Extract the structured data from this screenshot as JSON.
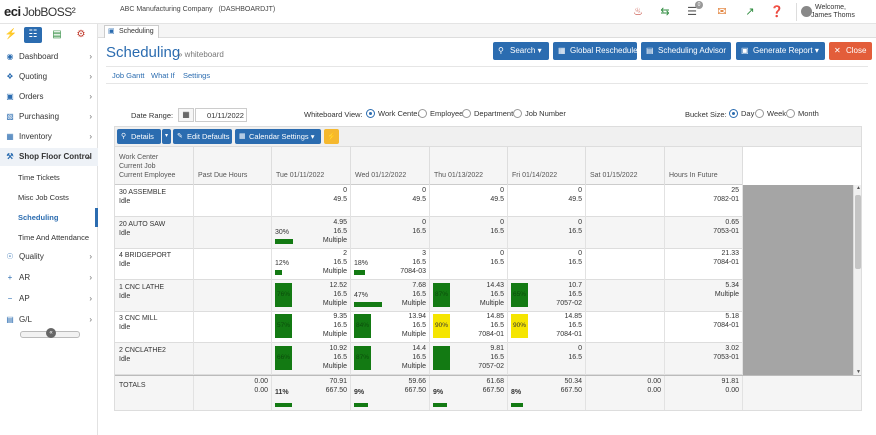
{
  "app": {
    "brand": "eci",
    "product": "JobBOSS²",
    "company": "ABC Manufacturing Company",
    "session": "(DASHBOARDJT)",
    "welcome": "Welcome,",
    "user": "James Thoms",
    "alert_count": "0"
  },
  "sidebar": {
    "items": [
      {
        "label": "Dashboard",
        "icon": "gauge-icon"
      },
      {
        "label": "Quoting",
        "icon": "quote-icon"
      },
      {
        "label": "Orders",
        "icon": "truck-icon"
      },
      {
        "label": "Purchasing",
        "icon": "cart-icon"
      },
      {
        "label": "Inventory",
        "icon": "inventory-icon"
      },
      {
        "label": "Shop Floor Control",
        "icon": "wrench-icon"
      },
      {
        "label": "Quality",
        "icon": "globe-icon"
      },
      {
        "label": "AR",
        "icon": "plus-icon"
      },
      {
        "label": "AP",
        "icon": "minus-icon"
      },
      {
        "label": "G/L",
        "icon": "ledger-icon"
      }
    ],
    "sub_items": [
      "Time Tickets",
      "Misc Job Costs",
      "Scheduling",
      "Time And Attendance"
    ],
    "active_sub": "Scheduling"
  },
  "tab": {
    "label": "Scheduling"
  },
  "header": {
    "title": "Scheduling",
    "subtitle": "» whiteboard",
    "buttons": {
      "search": "Search",
      "reschedule": "Global Reschedule",
      "advisor": "Scheduling Advisor",
      "report": "Generate Report",
      "close": "Close"
    }
  },
  "subnav": {
    "links": [
      "Job Gantt",
      "What If",
      "Settings"
    ]
  },
  "filters": {
    "date_label": "Date Range:",
    "date_value": "01/11/2022",
    "view_label": "Whiteboard View:",
    "view_options": [
      "Work Center",
      "Employee",
      "Department",
      "Job Number"
    ],
    "view_selected": "Work Center",
    "bucket_label": "Bucket Size:",
    "bucket_options": [
      "Day",
      "Week",
      "Month"
    ],
    "bucket_selected": "Day"
  },
  "toolbar": {
    "details": "Details",
    "edit_defaults": "Edit Defaults",
    "calendar_settings": "Calendar Settings"
  },
  "grid": {
    "header_lines": [
      "Work Center",
      "Current Job",
      "Current Employee"
    ],
    "columns": [
      "Past Due Hours",
      "Tue 01/11/2022",
      "Wed 01/12/2022",
      "Thu 01/13/2022",
      "Fri 01/14/2022",
      "Sat 01/15/2022",
      "Hours In Future"
    ],
    "rows": [
      {
        "name": "30 ASSEMBLE",
        "status": "Idle",
        "days": [
          {
            "v1": "0",
            "v2": "49.5",
            "v3": "",
            "pct": "",
            "fill": 0,
            "style": "none"
          },
          {
            "v1": "0",
            "v2": "49.5",
            "v3": "",
            "pct": "",
            "fill": 0,
            "style": "none"
          },
          {
            "v1": "0",
            "v2": "49.5",
            "v3": "",
            "pct": "",
            "fill": 0,
            "style": "none"
          },
          {
            "v1": "0",
            "v2": "49.5",
            "v3": "",
            "pct": "",
            "fill": 0,
            "style": "none"
          }
        ],
        "future": {
          "v1": "25",
          "v2": "7082-01"
        }
      },
      {
        "name": "20 AUTO SAW",
        "status": "Idle",
        "days": [
          {
            "v1": "4.95",
            "v2": "16.5",
            "v3": "Multiple",
            "pct": "30%",
            "fill": 0.3,
            "style": "bar"
          },
          {
            "v1": "0",
            "v2": "16.5",
            "v3": "",
            "pct": "",
            "fill": 0,
            "style": "none"
          },
          {
            "v1": "0",
            "v2": "16.5",
            "v3": "",
            "pct": "",
            "fill": 0,
            "style": "none"
          },
          {
            "v1": "0",
            "v2": "16.5",
            "v3": "",
            "pct": "",
            "fill": 0,
            "style": "none"
          }
        ],
        "future": {
          "v1": "0.65",
          "v2": "7053-01"
        }
      },
      {
        "name": "4 BRIDGEPORT",
        "status": "Idle",
        "days": [
          {
            "v1": "2",
            "v2": "16.5",
            "v3": "Multiple",
            "pct": "12%",
            "fill": 0.12,
            "style": "bar"
          },
          {
            "v1": "3",
            "v2": "16.5",
            "v3": "7084-03",
            "pct": "18%",
            "fill": 0.18,
            "style": "bar"
          },
          {
            "v1": "0",
            "v2": "16.5",
            "v3": "",
            "pct": "",
            "fill": 0,
            "style": "none"
          },
          {
            "v1": "0",
            "v2": "16.5",
            "v3": "",
            "pct": "",
            "fill": 0,
            "style": "none"
          }
        ],
        "future": {
          "v1": "21.33",
          "v2": "7084-01"
        }
      },
      {
        "name": "1 CNC LATHE",
        "status": "Idle",
        "days": [
          {
            "v1": "12.52",
            "v2": "16.5",
            "v3": "Multiple",
            "pct": "76%",
            "fill": 0.76,
            "style": "box"
          },
          {
            "v1": "7.68",
            "v2": "16.5",
            "v3": "Multiple",
            "pct": "47%",
            "fill": 0.47,
            "style": "bar"
          },
          {
            "v1": "14.43",
            "v2": "16.5",
            "v3": "Multiple",
            "pct": "87%",
            "fill": 0.87,
            "style": "box"
          },
          {
            "v1": "10.7",
            "v2": "16.5",
            "v3": "7057-02",
            "pct": "65%",
            "fill": 0.65,
            "style": "box"
          }
        ],
        "future": {
          "v1": "5.34",
          "v2": "Multiple"
        }
      },
      {
        "name": "3 CNC MILL",
        "status": "Idle",
        "days": [
          {
            "v1": "9.35",
            "v2": "16.5",
            "v3": "Multiple",
            "pct": "57%",
            "fill": 0.57,
            "style": "box"
          },
          {
            "v1": "13.94",
            "v2": "16.5",
            "v3": "Multiple",
            "pct": "84%",
            "fill": 0.84,
            "style": "box"
          },
          {
            "v1": "14.85",
            "v2": "16.5",
            "v3": "7084-01",
            "pct": "90%",
            "fill": 0.9,
            "style": "yellow"
          },
          {
            "v1": "14.85",
            "v2": "16.5",
            "v3": "7084-01",
            "pct": "90%",
            "fill": 0.9,
            "style": "yellow"
          }
        ],
        "future": {
          "v1": "5.18",
          "v2": "7084-01"
        }
      },
      {
        "name": "2 CNCLATHE2",
        "status": "Idle",
        "days": [
          {
            "v1": "10.92",
            "v2": "16.5",
            "v3": "Multiple",
            "pct": "66%",
            "fill": 0.66,
            "style": "box"
          },
          {
            "v1": "14.4",
            "v2": "16.5",
            "v3": "Multiple",
            "pct": "87%",
            "fill": 0.87,
            "style": "box"
          },
          {
            "v1": "9.81",
            "v2": "16.5",
            "v3": "7057-02",
            "pct": "",
            "fill": 0.59,
            "style": "box"
          },
          {
            "v1": "0",
            "v2": "16.5",
            "v3": "",
            "pct": "",
            "fill": 0,
            "style": "none"
          }
        ],
        "future": {
          "v1": "3.02",
          "v2": "7053-01"
        }
      }
    ],
    "totals": {
      "label": "TOTALS",
      "past_due": {
        "v1": "0.00",
        "v2": "0.00"
      },
      "days": [
        {
          "v1": "70.91",
          "v2": "667.50",
          "pct": "11%",
          "fill": 0.11
        },
        {
          "v1": "59.66",
          "v2": "667.50",
          "pct": "9%",
          "fill": 0.09
        },
        {
          "v1": "61.68",
          "v2": "667.50",
          "pct": "9%",
          "fill": 0.09
        },
        {
          "v1": "50.34",
          "v2": "667.50",
          "pct": "8%",
          "fill": 0.08
        }
      ],
      "sat": {
        "v1": "0.00",
        "v2": "0.00"
      },
      "future": {
        "v1": "91.81",
        "v2": "0.00"
      }
    }
  }
}
